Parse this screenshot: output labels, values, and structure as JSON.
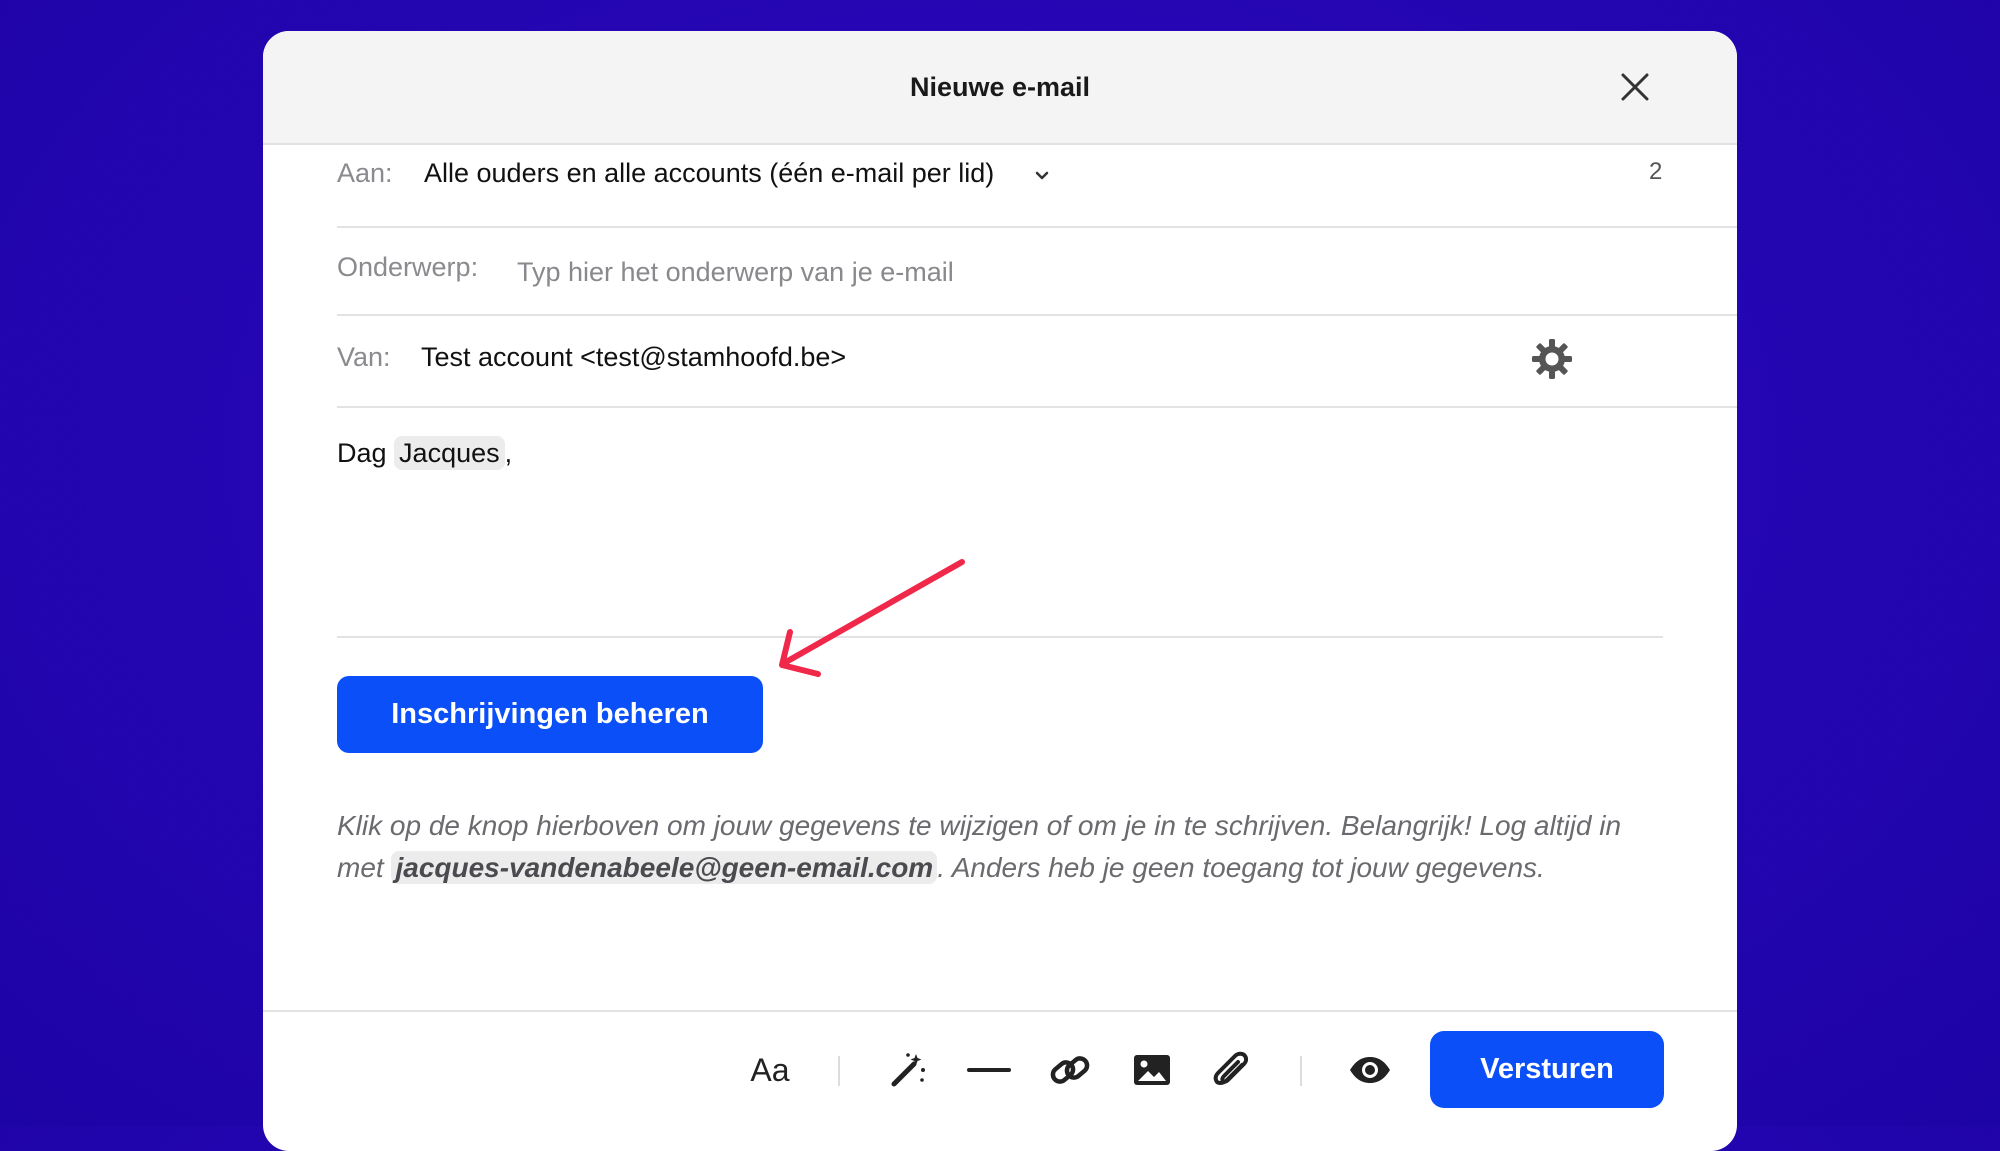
{
  "modal": {
    "title": "Nieuwe e-mail"
  },
  "to": {
    "label": "Aan:",
    "value": "Alle ouders en alle accounts (één e-mail per lid)",
    "count": "2"
  },
  "subject": {
    "label": "Onderwerp:",
    "value": "",
    "placeholder": "Typ hier het onderwerp van je e-mail"
  },
  "from": {
    "label": "Van:",
    "value": "Test account <test@stamhoofd.be>"
  },
  "body": {
    "greeting_prefix": "Dag",
    "greeting_name": "Jacques",
    "greeting_suffix": ",",
    "button_label": "Inschrijvingen beheren",
    "note_part1": "Klik op de knop hierboven om jouw gegevens te wijzigen of om je in te schrijven. Belangrijk! Log altijd in met ",
    "note_email": "jacques-vandenabeele@geen-email.com",
    "note_part2": ". Anders heb je geen toegang tot jouw gegevens."
  },
  "toolbar": {
    "text_style_label": "Aa",
    "send_label": "Versturen"
  },
  "icons": {
    "close": "close-icon",
    "chevron": "chevron-down-icon",
    "settings": "gear-icon",
    "magic": "magic-wand-icon",
    "divider": "horizontal-rule-icon",
    "link": "link-icon",
    "image": "image-icon",
    "attachment": "paperclip-icon",
    "preview": "eye-icon",
    "annotation": "arrow-annotation"
  },
  "colors": {
    "background": "#2606b4",
    "primary": "#0a4ff7",
    "annotation": "#f0284a"
  }
}
